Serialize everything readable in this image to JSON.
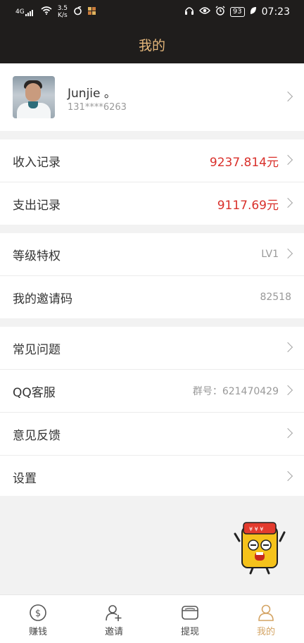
{
  "status_bar": {
    "signal_label": "4G",
    "speed_value": "3.5",
    "speed_unit": "K/s",
    "battery": "93",
    "time": "07:23"
  },
  "header": {
    "title": "我的"
  },
  "profile": {
    "name": "Junjie 。",
    "phone": "131****6263"
  },
  "sections": {
    "income": {
      "label": "收入记录",
      "value": "9237.814元"
    },
    "expense": {
      "label": "支出记录",
      "value": "9117.69元"
    },
    "level": {
      "label": "等级特权",
      "value": "LV1"
    },
    "invite_code": {
      "label": "我的邀请码",
      "value": "82518"
    },
    "faq": {
      "label": "常见问题"
    },
    "qq_service": {
      "label": "QQ客服",
      "value": "群号：621470429"
    },
    "feedback": {
      "label": "意见反馈"
    },
    "settings": {
      "label": "设置"
    }
  },
  "tabbar": {
    "items": [
      {
        "label": "赚钱",
        "icon": "dollar-coin-icon"
      },
      {
        "label": "邀请",
        "icon": "add-person-icon"
      },
      {
        "label": "提现",
        "icon": "wallet-icon"
      },
      {
        "label": "我的",
        "icon": "person-icon",
        "active": true
      }
    ]
  },
  "colors": {
    "header_bg": "#1f1d1c",
    "accent_gold": "#d4a464",
    "amount_red": "#d9302b"
  }
}
